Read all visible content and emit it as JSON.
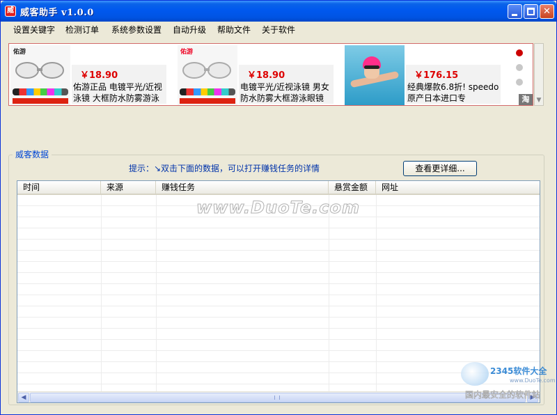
{
  "window": {
    "title": "威客助手  v1.0.0",
    "icon_char": "威"
  },
  "menu": {
    "items": [
      "设置关键字",
      "检测订单",
      "系统参数设置",
      "自动升级",
      "帮助文件",
      "关于软件"
    ]
  },
  "banner": {
    "ads": [
      {
        "brand": "佑游",
        "price": "￥18.90",
        "desc": "佑游正品 电镀平光/近视泳镜 大框防水防雾游泳"
      },
      {
        "brand": "佑游",
        "price": "￥18.90",
        "desc": "电镀平光/近视泳镜 男女防水防雾大框游泳眼镜"
      },
      {
        "brand": "",
        "price": "￥176.15",
        "desc": "经典爆款6.8折! speedo 原产日本进口专"
      }
    ],
    "active_index": 0,
    "taobao_label": "淘"
  },
  "group": {
    "legend": "威客数据",
    "hint": "提示：↘双击下面的数据，可以打开赚钱任务的详情",
    "detail_button": "查看更详细..."
  },
  "table": {
    "columns": [
      "时间",
      "来源",
      "赚钱任务",
      "悬赏金额",
      "网址"
    ],
    "rows": []
  },
  "watermark": {
    "main": "www.DuoTe.com",
    "brand": "2345软件大全",
    "url": "www.DuoTe.com",
    "foot": "国内最安全的软件站"
  },
  "colors": {
    "title_bar": "#0054e3",
    "accent_red": "#cc0000",
    "hint_blue": "#0033aa"
  }
}
